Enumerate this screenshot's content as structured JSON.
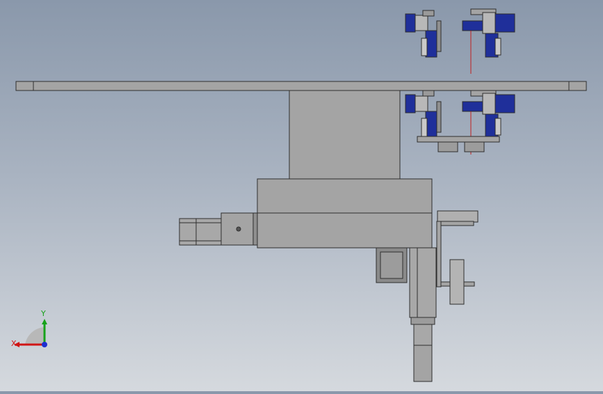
{
  "viewport": {
    "background_top": "#8a98ab",
    "background_bottom": "#d5d9de"
  },
  "colors": {
    "part_gray": "#a4a4a4",
    "part_dark": "#7f7f7f",
    "edge": "#2e2e2e",
    "cylinder_blue": "#1f2f9a",
    "axis_x": "#d01515",
    "axis_y": "#17a21a",
    "axis_z": "#1d2fd0"
  },
  "triad": {
    "x_label": "X",
    "y_label": "Y"
  },
  "icons": {
    "triad": "coordinate-triad-icon"
  }
}
